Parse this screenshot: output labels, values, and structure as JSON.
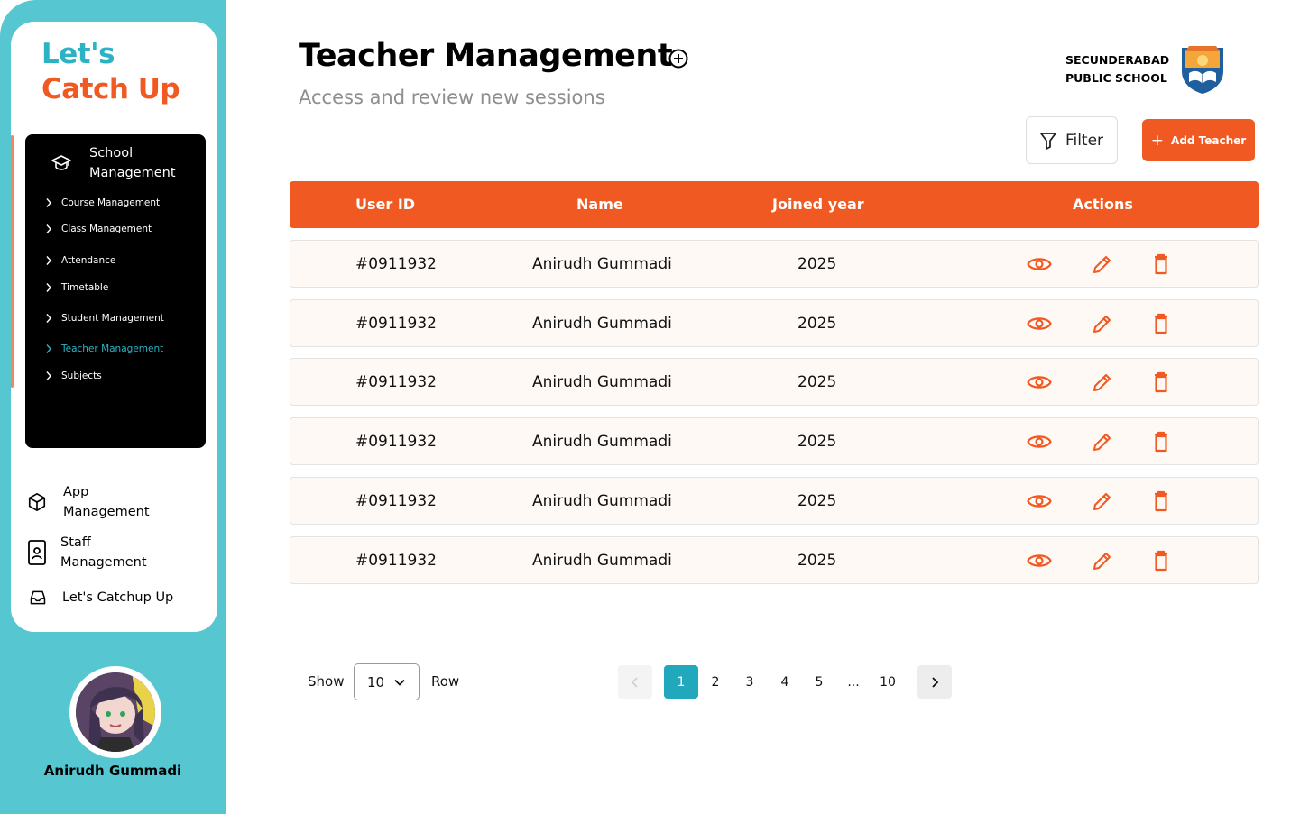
{
  "brand": {
    "line1": "Let's",
    "line2": "Catch Up",
    "primary_color": "#F05A22",
    "teal_color": "#56C6D1"
  },
  "sidebar": {
    "school_section": {
      "title_line1": "School",
      "title_line2": "Management",
      "icon": "graduation-cap-icon",
      "items": [
        {
          "label": "Course Management",
          "active": false
        },
        {
          "label": "Class Management",
          "active": false
        },
        {
          "label": "Attendance",
          "active": false
        },
        {
          "label": "Timetable",
          "active": false
        },
        {
          "label": "Student Management",
          "active": false
        },
        {
          "label": "Teacher Management",
          "active": true
        },
        {
          "label": "Subjects",
          "active": false
        }
      ]
    },
    "nav": [
      {
        "line1": "App",
        "line2": "Management",
        "icon": "cube-icon"
      },
      {
        "line1": "Staff",
        "line2": "Management",
        "icon": "staff-badge-icon"
      },
      {
        "line1": "Let's Catchup Up",
        "line2": "",
        "icon": "inbox-icon"
      }
    ]
  },
  "user": {
    "name": "Anirudh Gummadi"
  },
  "header": {
    "title": "Teacher Management",
    "subtitle": "Access and review new sessions",
    "school_line1": "SECUNDERABAD",
    "school_line2": "PUBLIC SCHOOL"
  },
  "toolbar": {
    "filter_label": "Filter",
    "add_label": "Add Teacher"
  },
  "table": {
    "columns": [
      "User ID",
      "Name",
      "Joined year",
      "Actions"
    ],
    "rows": [
      {
        "user_id": "#0911932",
        "name": "Anirudh Gummadi",
        "year": "2025"
      },
      {
        "user_id": "#0911932",
        "name": "Anirudh Gummadi",
        "year": "2025"
      },
      {
        "user_id": "#0911932",
        "name": "Anirudh Gummadi",
        "year": "2025"
      },
      {
        "user_id": "#0911932",
        "name": "Anirudh Gummadi",
        "year": "2025"
      },
      {
        "user_id": "#0911932",
        "name": "Anirudh Gummadi",
        "year": "2025"
      },
      {
        "user_id": "#0911932",
        "name": "Anirudh Gummadi",
        "year": "2025"
      }
    ]
  },
  "pagination": {
    "show_label": "Show",
    "rows_value": "10",
    "row_label": "Row",
    "pages": [
      "1",
      "2",
      "3",
      "4",
      "5",
      "...",
      "10"
    ],
    "current": "1"
  }
}
